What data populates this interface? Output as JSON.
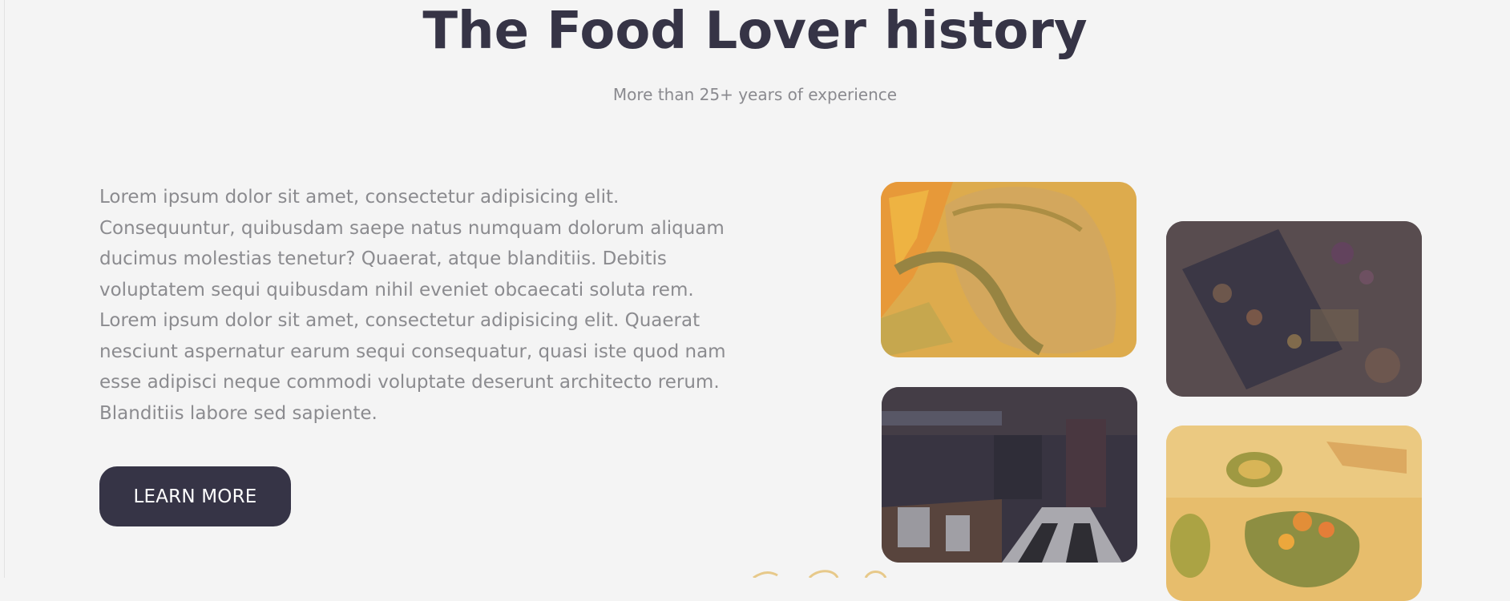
{
  "section": {
    "title": "The Food Lover history",
    "subtitle": "More than 25+ years of experience"
  },
  "about": {
    "paragraphs": [
      "Lorem ipsum dolor sit amet, consectetur adipisicing elit. Consequuntur, quibusdam saepe natus numquam dolorum aliquam ducimus molestias tenetur? Quaerat, atque blanditiis. Debitis voluptatem sequi quibusdam nihil eveniet obcaecati soluta rem.",
      "Lorem ipsum dolor sit amet, consectetur adipisicing elit. Quaerat nesciunt aspernatur earum sequi consequatur, quasi iste quod nam esse adipisci neque commodi voluptate deserunt architecto rerum. Blanditiis labore sed sapiente."
    ],
    "button_label": "LEARN MORE"
  },
  "gallery": {
    "images": [
      {
        "name": "grilled-meat-photo",
        "tint": "#e5b552"
      },
      {
        "name": "food-platter-photo",
        "tint": "#3a3846"
      },
      {
        "name": "restaurant-interior-photo",
        "tint": "#363446"
      },
      {
        "name": "salad-dish-photo",
        "tint": "#e5b552"
      }
    ]
  },
  "colors": {
    "background": "#f4f4f4",
    "heading": "#363446",
    "body_text": "#8b8b8f",
    "accent_yellow": "#e5b552"
  }
}
